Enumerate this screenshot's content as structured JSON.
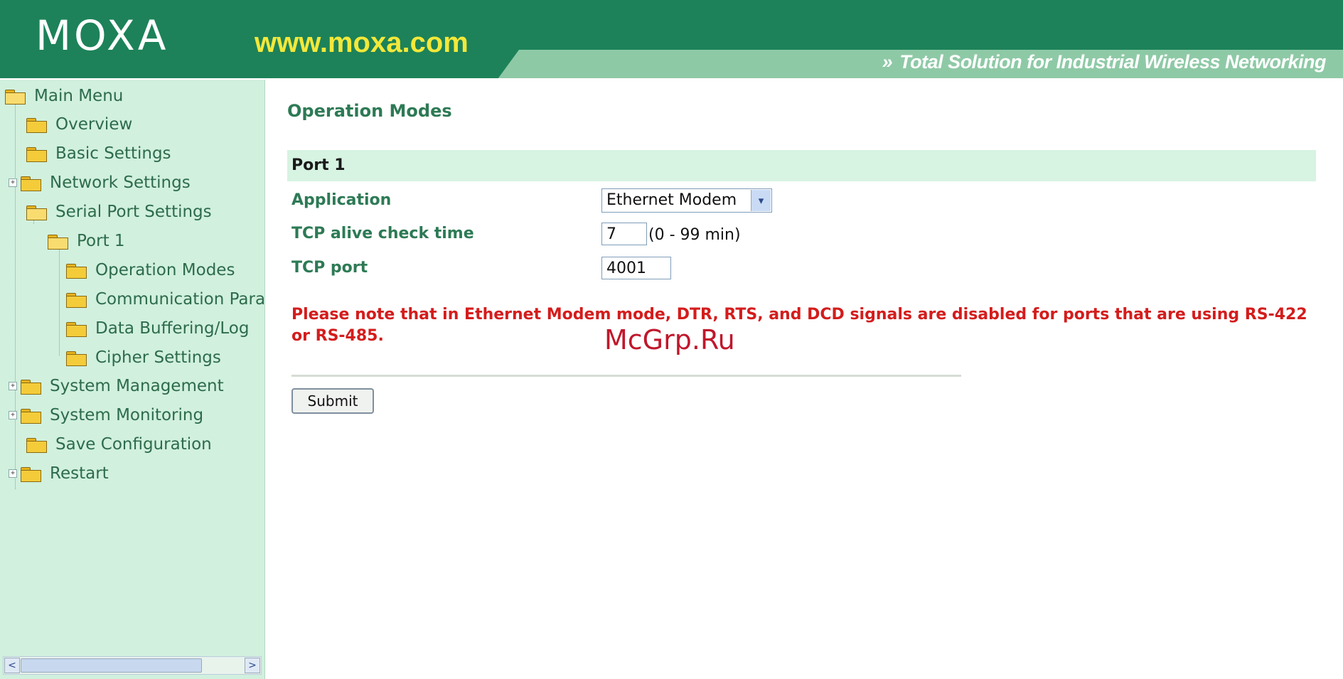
{
  "header": {
    "logo": "MOXA",
    "url": "www.moxa.com",
    "tagline_arrow": "»",
    "tagline": "Total Solution for Industrial Wireless Networking"
  },
  "sidebar": {
    "items": [
      {
        "label": "Main Menu"
      },
      {
        "label": "Overview"
      },
      {
        "label": "Basic Settings"
      },
      {
        "label": "Network Settings"
      },
      {
        "label": "Serial Port Settings"
      },
      {
        "label": "Port 1"
      },
      {
        "label": "Operation Modes"
      },
      {
        "label": "Communication Para"
      },
      {
        "label": "Data Buffering/Log"
      },
      {
        "label": "Cipher Settings"
      },
      {
        "label": "System Management"
      },
      {
        "label": "System Monitoring"
      },
      {
        "label": "Save Configuration"
      },
      {
        "label": "Restart"
      }
    ],
    "expander_symbol": "+",
    "scroll_left": "<",
    "scroll_right": ">"
  },
  "main": {
    "title": "Operation Modes",
    "port_title": "Port 1",
    "application_label": "Application",
    "application_value": "Ethernet Modem",
    "select_arrow": "▾",
    "alive_label": "TCP alive check time",
    "alive_value": "7",
    "alive_hint": "(0 - 99 min)",
    "port_label": "TCP port",
    "port_value": "4001",
    "warning": "Please note that in Ethernet Modem mode, DTR, RTS, and DCD signals are disabled for ports that are using RS-422 or RS-485.",
    "submit_label": "Submit"
  },
  "watermark": "McGrp.Ru",
  "colors": {
    "header_green": "#1d8259",
    "sidebar_bg": "#d1f0de",
    "label_green": "#2d7a55",
    "warning_red": "#d41c1c"
  }
}
